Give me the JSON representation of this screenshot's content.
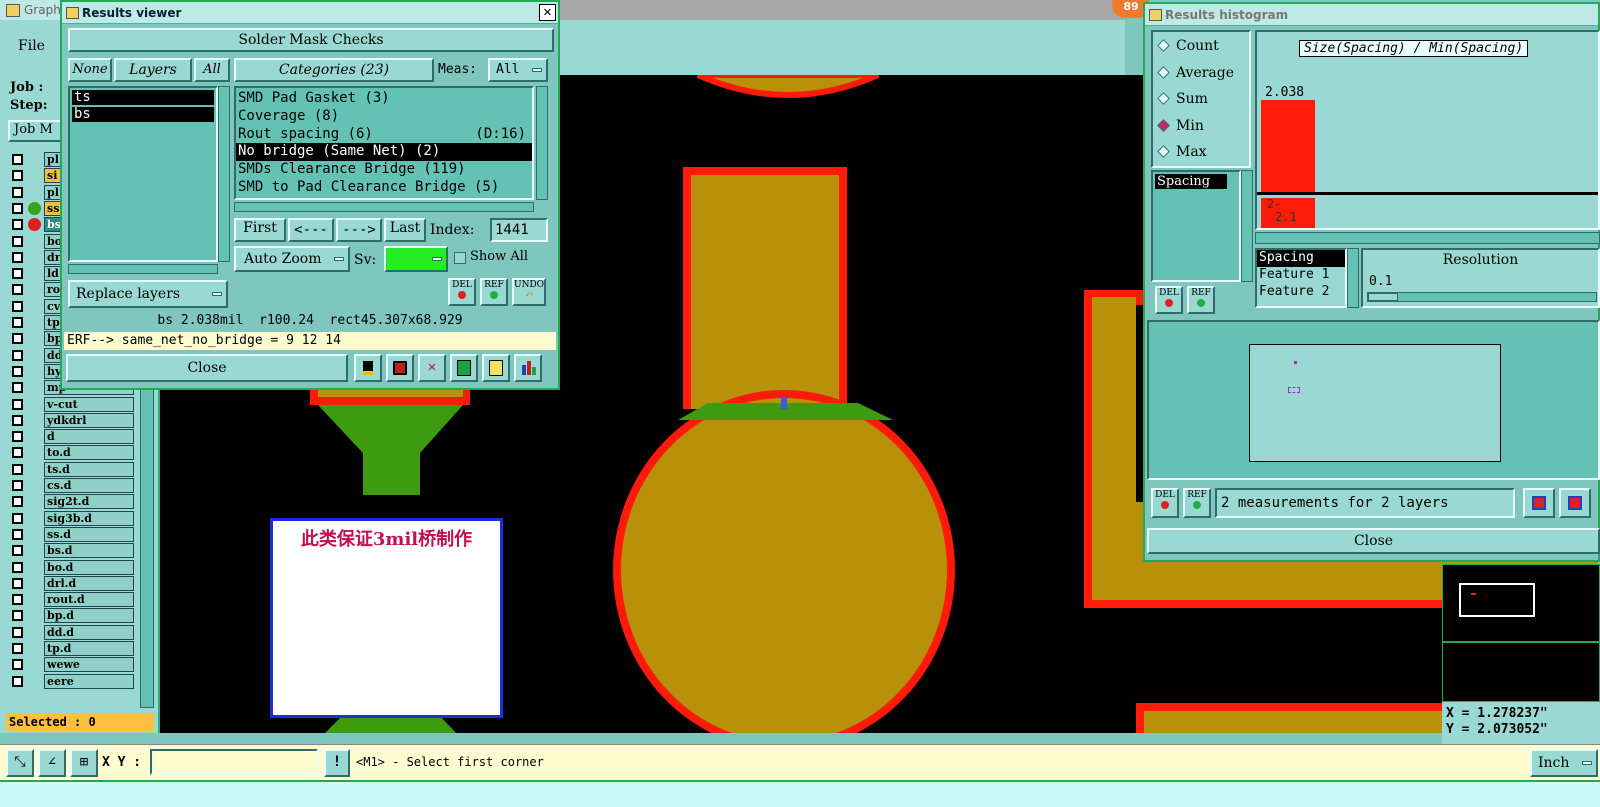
{
  "main_window": {
    "title_fragment": "Graph",
    "menu_file": "File",
    "job_label": "Job :",
    "step_label": "Step:",
    "job_button": "Job M",
    "selected_label": "Selected : 0",
    "layers": [
      "pl",
      "si",
      "pl",
      "ss",
      "bs",
      "bo",
      "dr",
      "ld",
      "ro",
      "cv",
      "tp",
      "bp",
      "dd",
      "hydd",
      "mp",
      "v-cut",
      "ydkdrl",
      "d",
      "to.d",
      "ts.d",
      "cs.d",
      "sig2t.d",
      "sig3b.d",
      "ss.d",
      "bs.d",
      "bo.d",
      "drl.d",
      "rout.d",
      "bp.d",
      "dd.d",
      "tp.d",
      "wewe",
      "eere"
    ],
    "annotation_text": "此类保证3mil桥制作",
    "badge_count": "89",
    "xy_label": "X Y :",
    "xy_value": "",
    "status_message": "<M1> - Select first corner",
    "units": "Inch",
    "coord_x": "X = 1.278237\"",
    "coord_y": "Y = 2.073052\""
  },
  "results_viewer": {
    "title": "Results viewer",
    "header": "Solder Mask Checks",
    "none_btn": "None",
    "layers_btn": "Layers",
    "all_btn": "All",
    "categories_btn": "Categories (23)",
    "meas_label": "Meas:",
    "meas_value": "All",
    "layer_items": [
      "ts",
      "bs"
    ],
    "categories": [
      {
        "label": "SMD Pad Gasket (3)",
        "extra": ""
      },
      {
        "label": "Coverage (8)",
        "extra": ""
      },
      {
        "label": "Rout spacing (6)",
        "extra": "(D:16)"
      },
      {
        "label": "No bridge (Same Net) (2)",
        "extra": ""
      },
      {
        "label": "SMDs Clearance Bridge (119)",
        "extra": ""
      },
      {
        "label": "SMD to Pad Clearance Bridge (5)",
        "extra": ""
      }
    ],
    "first_btn": "First",
    "prev_btn": "<---",
    "next_btn": "--->",
    "last_btn": "Last",
    "index_label": "Index:",
    "index_value": "1441",
    "auto_zoom": "Auto Zoom",
    "sv_label": "Sv:",
    "show_all": "Show All",
    "replace_layers": "Replace layers",
    "del": "DEL",
    "ref": "REF",
    "undo": "UNDO",
    "info_line": "bs 2.038mil  r100.24  rect45.307x68.929",
    "erf_line": "ERF--> same_net_no_bridge = 9 12 14",
    "close": "Close"
  },
  "histogram": {
    "title": "Results histogram",
    "options": [
      "Count",
      "Average",
      "Sum",
      "Min",
      "Max"
    ],
    "selected_option": "Min",
    "list_item": "Spacing",
    "chart_title": "Size(Spacing) / Min(Spacing)",
    "bar_value": "2.038",
    "bar_label_1": "2-",
    "bar_label_2": "2.1",
    "del": "DEL",
    "ref": "REF",
    "spacing_items": [
      "Spacing",
      "Feature 1",
      "Feature 2"
    ],
    "resolution_label": "Resolution",
    "resolution_value": "0.1",
    "measurements_text": "2 measurements for 2 layers",
    "close": "Close",
    "chart_data": {
      "type": "bar",
      "title": "Size(Spacing) / Min(Spacing)",
      "categories": [
        "2-2.1"
      ],
      "values": [
        2.038
      ]
    }
  },
  "colors": {
    "mask_red": "#ff1a0a",
    "copper": "#b8900a",
    "green": "#3e9b10",
    "teal": "#9ad9d3"
  }
}
